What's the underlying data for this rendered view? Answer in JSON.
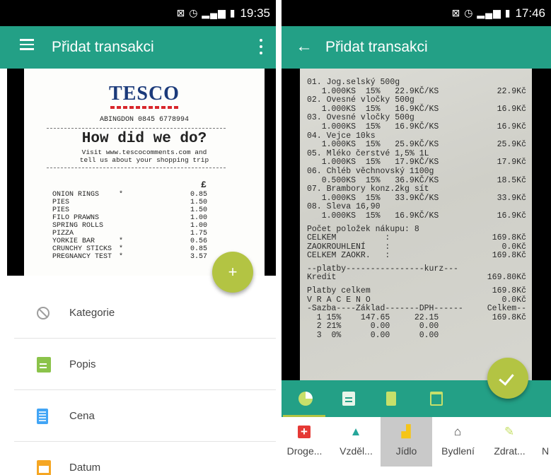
{
  "left": {
    "status": {
      "time": "19:35",
      "icons": "⊠ ◷ ▂▄▆ ▮"
    },
    "appbar": {
      "title": "Přidat transakci"
    },
    "receipt": {
      "logo": "TESCO",
      "store": "ABINGDON 0845 6778994",
      "headline": "How did we do?",
      "sub1": "Visit www.tescocomments.com and",
      "sub2": "tell us about your shopping trip",
      "currency": "£",
      "items": [
        {
          "name": "ONION RINGS",
          "mark": "*",
          "price": "0.85"
        },
        {
          "name": "PIES",
          "mark": "",
          "price": "1.50"
        },
        {
          "name": "PIES",
          "mark": "",
          "price": "1.50"
        },
        {
          "name": "FILO PRAWNS",
          "mark": "",
          "price": "1.00"
        },
        {
          "name": "SPRING ROLLS",
          "mark": "",
          "price": "1.00"
        },
        {
          "name": "PIZZA",
          "mark": "",
          "price": "1.75"
        },
        {
          "name": "YORKIE BAR",
          "mark": "*",
          "price": "0.56"
        },
        {
          "name": "CRUNCHY STICKS",
          "mark": "*",
          "price": "0.85"
        },
        {
          "name": "PREGNANCY TEST",
          "mark": "*",
          "price": "3.57"
        }
      ]
    },
    "fab": "+",
    "rows": [
      {
        "label": "Kategorie",
        "icon": "block-icon"
      },
      {
        "label": "Popis",
        "icon": "document-icon"
      },
      {
        "label": "Cena",
        "icon": "calculator-icon"
      },
      {
        "label": "Datum",
        "icon": "calendar-icon"
      }
    ]
  },
  "right": {
    "status": {
      "time": "17:46",
      "icons": "⊠ ◷ ▂▄▆ ▮"
    },
    "appbar": {
      "title": "Přidat transakci"
    },
    "receipt_lines": [
      {
        "l": "01. Jog.selský 500g",
        "r": ""
      },
      {
        "l": "   1.000KS  15%   22.9KČ/KS",
        "r": "22.9Kč"
      },
      {
        "l": "02. Ovesné vločky 500g",
        "r": ""
      },
      {
        "l": "   1.000KS  15%   16.9KČ/KS",
        "r": "16.9Kč"
      },
      {
        "l": "03. Ovesné vločky 500g",
        "r": ""
      },
      {
        "l": "   1.000KS  15%   16.9KČ/KS",
        "r": "16.9Kč"
      },
      {
        "l": "04. Vejce 10ks",
        "r": ""
      },
      {
        "l": "   1.000KS  15%   25.9KČ/KS",
        "r": "25.9Kč"
      },
      {
        "l": "05. Mléko čerstvé 1,5% 1L",
        "r": ""
      },
      {
        "l": "   1.000KS  15%   17.9KČ/KS",
        "r": "17.9Kč"
      },
      {
        "l": "06. Chléb věchnovský 1100g",
        "r": ""
      },
      {
        "l": "   0.500KS  15%   36.9KČ/KS",
        "r": "18.5Kč"
      },
      {
        "l": "07. Brambory konz.2kg sít",
        "r": ""
      },
      {
        "l": "   1.000KS  15%   33.9KČ/KS",
        "r": "33.9Kč"
      },
      {
        "l": "08. Sleva 16,90",
        "r": ""
      },
      {
        "l": "   1.000KS  15%   16.9KČ/KS",
        "r": "16.9Kč"
      },
      {
        "l": "",
        "r": ""
      },
      {
        "l": "Počet položek nákupu: 8",
        "r": ""
      },
      {
        "l": "CELKEM          :",
        "r": "169.8Kč"
      },
      {
        "l": "ZAOKROUHLENÍ    :",
        "r": "0.0Kč"
      },
      {
        "l": "CELKEM ZAOKR.   :",
        "r": "169.8Kč"
      },
      {
        "l": "",
        "r": ""
      },
      {
        "l": "--platby----------------kurz---",
        "r": ""
      },
      {
        "l": "Kredit",
        "r": "169.80Kč"
      },
      {
        "l": "",
        "r": ""
      },
      {
        "l": "Platby celkem",
        "r": "169.8Kč"
      },
      {
        "l": "V R A C E N O",
        "r": "0.0Kč"
      },
      {
        "l": "-Sazba----Základ-------DPH------",
        "r": "Celkem--"
      },
      {
        "l": "  1 15%    147.65     22.15",
        "r": "169.8Kč"
      },
      {
        "l": "  2 21%      0.00      0.00",
        "r": ""
      },
      {
        "l": "  3  0%      0.00      0.00",
        "r": ""
      }
    ],
    "tabs": [
      {
        "name": "tab-chart",
        "icon": "pie-chart-icon"
      },
      {
        "name": "tab-description",
        "icon": "document-icon"
      },
      {
        "name": "tab-price",
        "icon": "calculator-icon"
      },
      {
        "name": "tab-date",
        "icon": "calendar-icon"
      }
    ],
    "categories": [
      {
        "label": "Droge...",
        "icon": "first-aid-icon",
        "glyph": "+"
      },
      {
        "label": "Vzděl...",
        "icon": "graduation-cap-icon",
        "glyph": "🎓"
      },
      {
        "label": "Jídlo",
        "icon": "food-icon",
        "glyph": "🍴"
      },
      {
        "label": "Bydlení",
        "icon": "home-icon",
        "glyph": "⌂"
      },
      {
        "label": "Zdrat...",
        "icon": "syringe-icon",
        "glyph": "✎"
      },
      {
        "label": "N",
        "icon": "",
        "glyph": ""
      }
    ]
  },
  "colors": {
    "primary": "#23a086",
    "accent": "#b3c443",
    "tesco_blue": "#1b3a7a",
    "tesco_red": "#d8262b"
  }
}
